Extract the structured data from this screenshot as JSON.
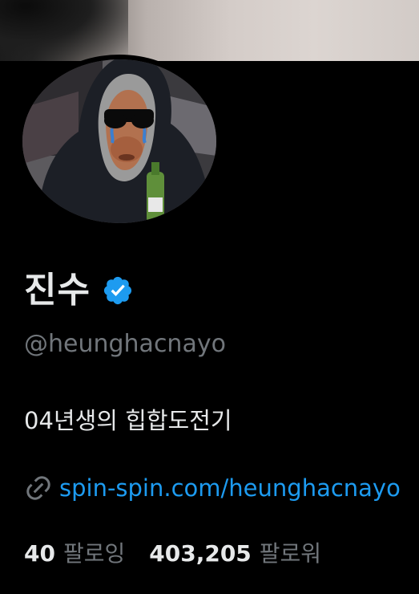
{
  "profile": {
    "display_name": "진수",
    "handle": "@heunghacnayo",
    "bio": "04년생의 힙합도전기",
    "link": "spin-spin.com/heunghacnayo",
    "verified": true
  },
  "stats": {
    "following_count": "40",
    "following_label": "팔로잉",
    "followers_count": "403,205",
    "followers_label": "팔로워"
  },
  "colors": {
    "background": "#000000",
    "primary_text": "#e7e9ea",
    "secondary_text": "#71767b",
    "link": "#1d9bf0",
    "verified_badge": "#1d9bf0"
  },
  "icons": {
    "verified": "verified-badge-icon",
    "link": "link-icon"
  }
}
